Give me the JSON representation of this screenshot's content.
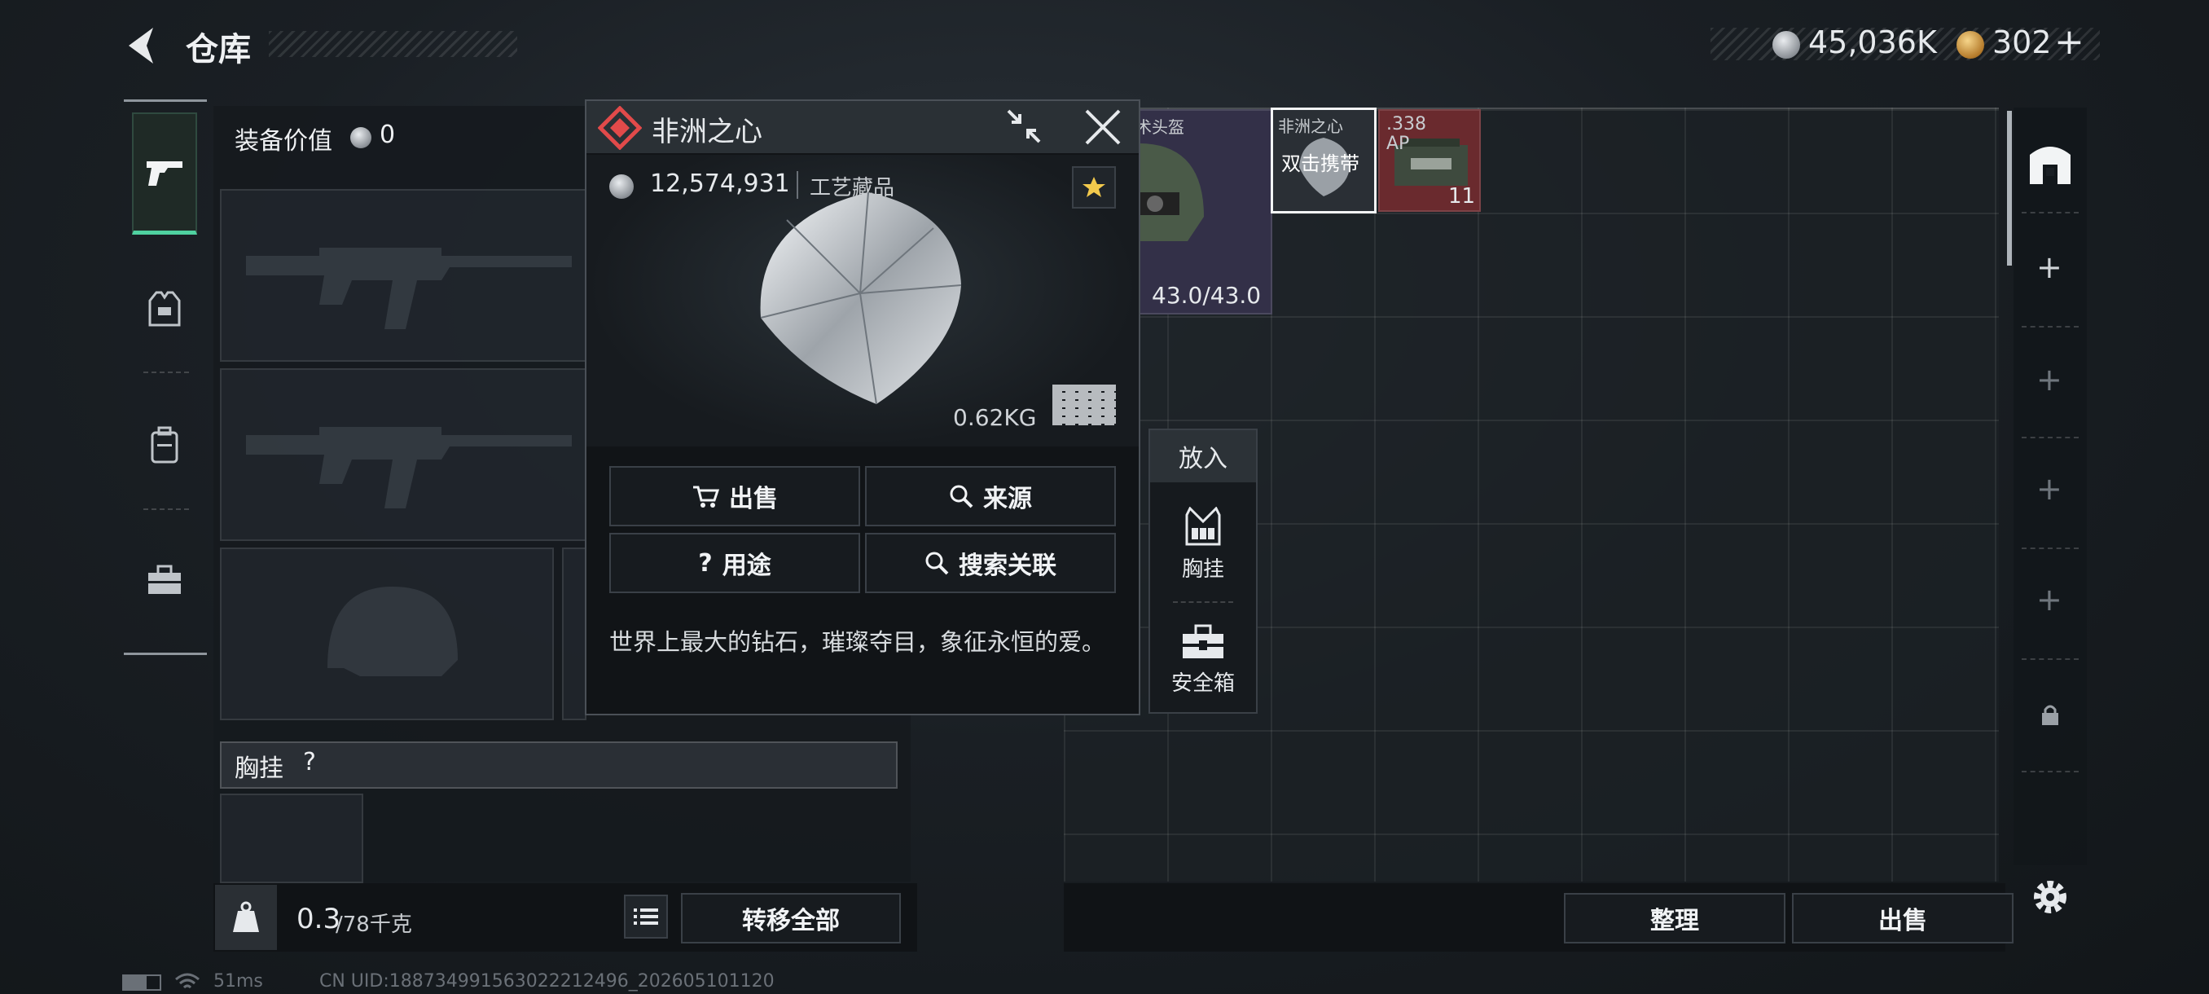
{
  "header": {
    "title": "仓库",
    "currency_silver": "45,036K",
    "currency_gold": "302"
  },
  "left": {
    "equip_value_label": "装备价值",
    "equip_value": "0",
    "chest_rig_label": "胸挂",
    "chest_rig_help": "?",
    "weight": "0.3",
    "weight_max": "/78千克",
    "weight_icon_text": "KG",
    "transfer_all": "转移全部"
  },
  "popup": {
    "title": "非洲之心",
    "price": "12,574,931",
    "category": "工艺藏品",
    "weight": "0.62KG",
    "actions": {
      "sell": "出售",
      "source": "来源",
      "usage": "用途",
      "search_related": "搜索关联"
    },
    "description": "世界上最大的钻石，璀璨夺目，象征永恒的爱。"
  },
  "put_into": {
    "title": "放入",
    "options": [
      {
        "label": "胸挂"
      },
      {
        "label": "安全箱"
      }
    ]
  },
  "grid_items": {
    "helmet": {
      "label": "术头盔",
      "durability": "43.0/43.0"
    },
    "diamond": {
      "label": "非洲之心",
      "tag": "双击携带"
    },
    "ammo": {
      "label1": ".338",
      "label2": "AP",
      "count": "11"
    }
  },
  "bottom": {
    "organize": "整理",
    "sell": "出售"
  },
  "status": {
    "ping": "51ms",
    "uid": "CN UID:18873499156302221249​6_202605101120"
  }
}
